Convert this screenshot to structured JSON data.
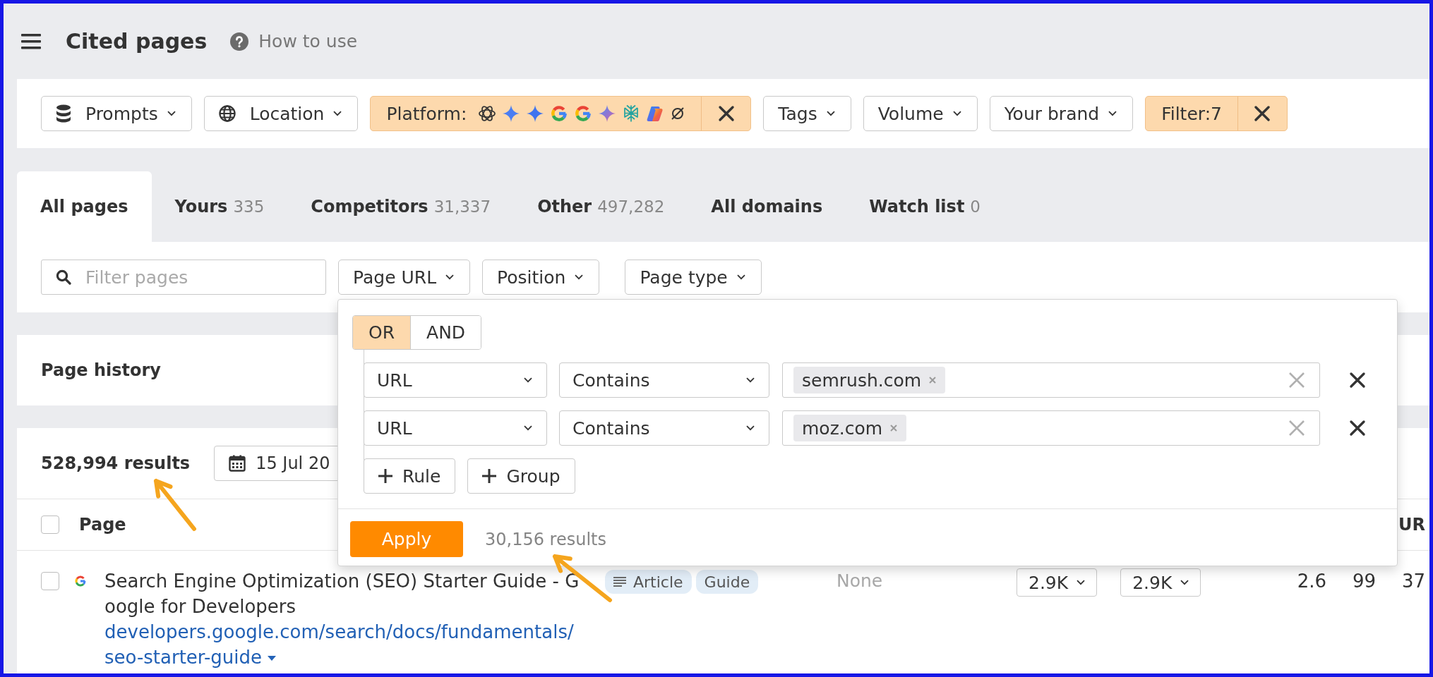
{
  "header": {
    "title": "Cited pages",
    "help_link": "How to use"
  },
  "filters": [
    {
      "kind": "menu",
      "label": "Prompts"
    },
    {
      "kind": "menu",
      "label": "Location"
    },
    {
      "kind": "applied",
      "label": "Platform:"
    },
    {
      "kind": "menu",
      "label": "Tags"
    },
    {
      "kind": "menu",
      "label": "Volume"
    },
    {
      "kind": "menu",
      "label": "Your brand"
    },
    {
      "kind": "applied",
      "label": "Filter:7"
    }
  ],
  "tabs": [
    {
      "label": "All pages",
      "selected": true
    },
    {
      "label": "Yours",
      "count": "335",
      "selected": false
    },
    {
      "label": "Competitors",
      "count": "31,337",
      "selected": false
    },
    {
      "label": "Other",
      "count": "497,282",
      "selected": false
    },
    {
      "label": "All domains",
      "selected": false
    },
    {
      "label": "Watch list",
      "count": "0",
      "selected": false
    }
  ],
  "page_filters": {
    "search": {
      "placeholder": "Filter pages"
    },
    "dropdowns": [
      "Page URL",
      "Position",
      "Page type"
    ]
  },
  "page_history": {
    "title": "Page history"
  },
  "results": {
    "count": "528,994 results",
    "date": "15 Jul 20"
  },
  "table": {
    "select_all": {
      "checked": false
    },
    "columns": [
      {
        "label": "Page"
      },
      {
        "label": "UR"
      }
    ],
    "rows": [
      {
        "checked": false,
        "title": "Search Engine Optimization (SEO) Starter Guide - Google for Developers",
        "url": "developers.google.com/search/docs/fundamentals/seo-starter-guide",
        "page_type": [
          "Article",
          "Guide"
        ],
        "column_3": "None",
        "column_4": "2.9K",
        "column_5": "2.9K",
        "column_6": "2.6",
        "column_7": "99",
        "ur": "37"
      }
    ]
  },
  "url_filter_popup": {
    "logic": [
      {
        "label": "OR",
        "selected": true
      },
      {
        "label": "AND",
        "selected": false
      }
    ],
    "rules": [
      {
        "field": "URL",
        "operator": "Contains",
        "values": [
          "semrush.com"
        ]
      },
      {
        "field": "URL",
        "operator": "Contains",
        "values": [
          "moz.com"
        ]
      }
    ],
    "add_buttons": [
      "Rule",
      "Group"
    ],
    "apply_button": "Apply",
    "result_count": "30,156 results"
  }
}
